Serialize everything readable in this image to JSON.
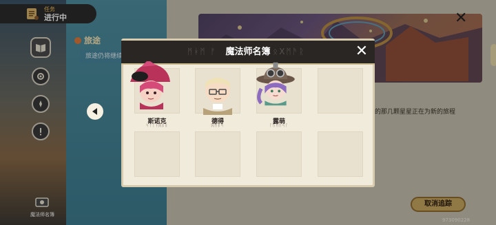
{
  "hud": {
    "task_label": "任务",
    "task_status": "进行中",
    "menu_book_label": "魔法师名簿"
  },
  "journey": {
    "title": "旅途",
    "description": "旅途仍将继续"
  },
  "scene": {
    "story_text": "的那几颗星星正在为新的旅程",
    "cancel_tracking": "取消追踪",
    "uid": "973090228"
  },
  "modal": {
    "title": "魔法师名簿",
    "title_rune_left": "ᛗᚼᛗ ᚠ",
    "title_rune_right": "ᛟXᛗᚫᚱ",
    "characters": [
      {
        "name": "斯诺克",
        "rune": "ᛋᛏᛁᚾᛞᛒᚱ",
        "hair_color": "#d64a7a",
        "hat_color": "#b8325a"
      },
      {
        "name": "德得",
        "rune": "ᛞᛗᛒᛋ",
        "hair_color": "#efe2b6",
        "hat_color": "#8a8a7a"
      },
      {
        "name": "露萌",
        "rune": "ᛚᚢᛗᛖᛋᛚ",
        "hair_color": "#8d6bbf",
        "hat_color": "#6a5648"
      },
      {
        "name": "",
        "rune": ""
      }
    ],
    "empty_slots": 4
  },
  "colors": {
    "modal_bg": "#f1ebdc",
    "header_bg": "#2a2623",
    "slot_bg": "#e8e1cf",
    "accent_gold": "#c9a860"
  }
}
